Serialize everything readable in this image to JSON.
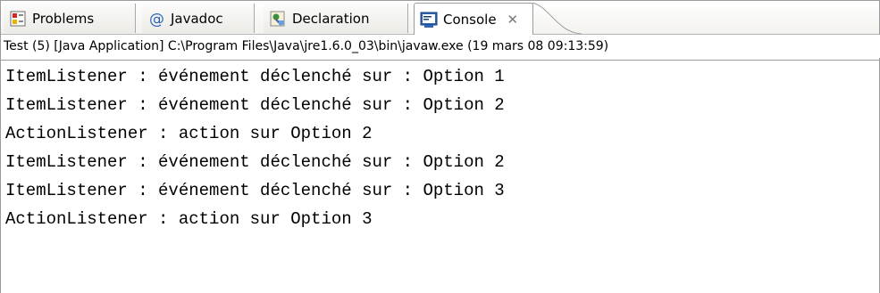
{
  "tabs": [
    {
      "label": "Problems",
      "icon": "problems-icon"
    },
    {
      "label": "Javadoc",
      "icon": "at-icon"
    },
    {
      "label": "Declaration",
      "icon": "declaration-icon"
    },
    {
      "label": "Console",
      "icon": "console-icon",
      "active": true,
      "close": "✕"
    }
  ],
  "status": "Test (5) [Java Application] C:\\Program Files\\Java\\jre1.6.0_03\\bin\\javaw.exe (19 mars 08 09:13:59)",
  "console_lines": [
    "ItemListener : événement déclenché sur : Option 1",
    "ItemListener : événement déclenché sur : Option 2",
    "ActionListener : action sur Option 2",
    "ItemListener : événement déclenché sur : Option 2",
    "ItemListener : événement déclenché sur : Option 3",
    "ActionListener : action sur Option 3"
  ]
}
